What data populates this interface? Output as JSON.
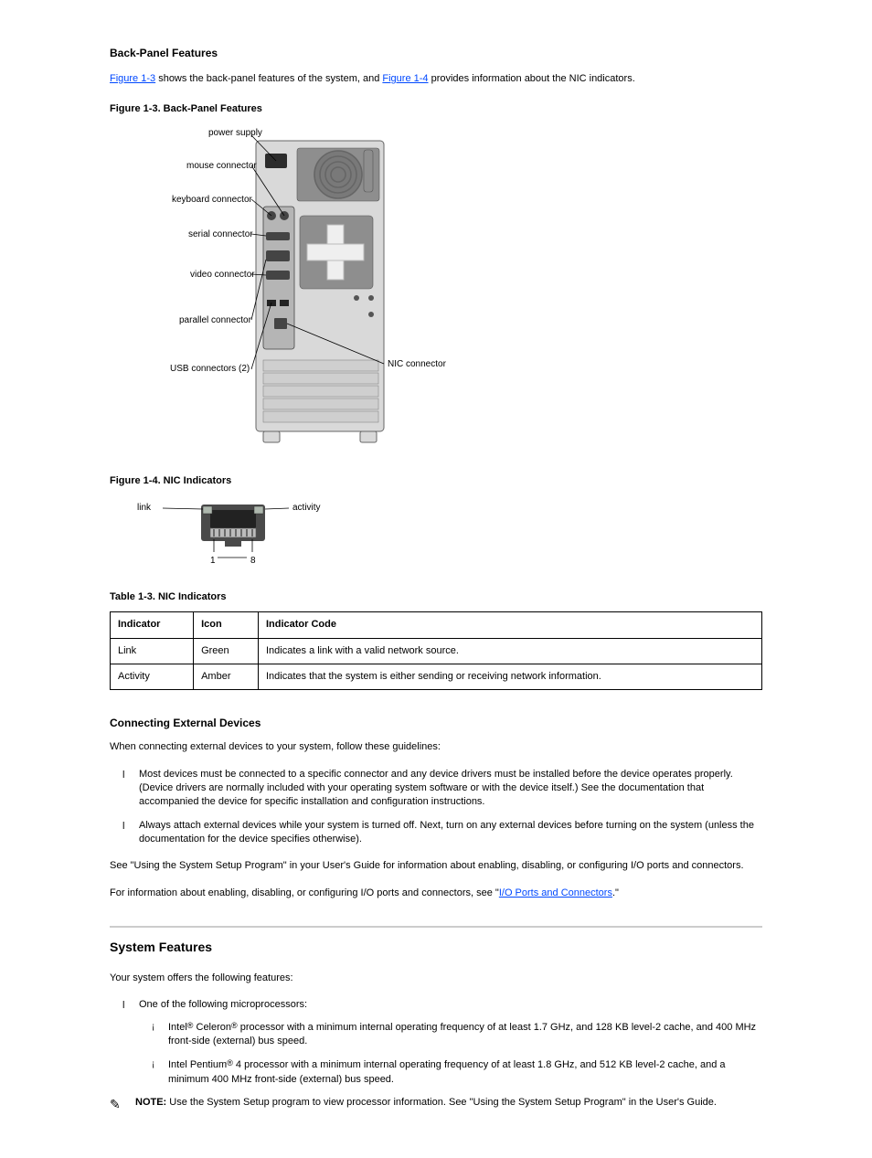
{
  "section1": {
    "title": "Back-Panel Features",
    "intro_parts": [
      " shows the back-panel features of the system, and ",
      " provides information about the NIC indicators."
    ],
    "link1": "Figure 1-3",
    "link2": "Figure 1-4",
    "fig3_label": "Figure 1-3. Back-Panel Features",
    "fig3_labels": {
      "power_supply": "power supply",
      "mouse": "mouse connector",
      "keyboard": "keyboard connector",
      "serial": "serial connector",
      "video": "video connector",
      "parallel": "parallel connector",
      "usb": "USB connectors (2)",
      "nic": "NIC connector"
    },
    "fig4_label": "Figure 1-4. NIC Indicators",
    "fig4_labels": {
      "link": "link",
      "activity": "activity",
      "pin1": "1",
      "pin8": "8"
    },
    "table_label": "Table 1-3. NIC Indicators",
    "table": {
      "headers": [
        "Indicator",
        "Icon",
        "Indicator Code"
      ],
      "rows": [
        [
          "Link",
          "Green",
          "Indicates a link with a valid network source."
        ],
        [
          "Activity",
          "Amber",
          "Indicates that the system is either sending or receiving network information."
        ]
      ]
    },
    "device_sec_title": "Connecting External Devices",
    "device_para": "When connecting external devices to your system, follow these guidelines:",
    "bullet1": "Most devices must be connected to a specific connector and any device drivers must be installed before the device operates properly. (Device drivers are normally included with your operating system software or with the device itself.) See the documentation that accompanied the device for specific installation and configuration instructions.",
    "bullet2": "Always attach external devices while your system is turned off. Next, turn on any external devices before turning on the system (unless the documentation for the device specifies otherwise).",
    "note_para": "See \"Using the System Setup Program\" in your User's Guide for information about enabling, disabling, or configuring I/O ports and connectors.",
    "note_ref_link": "I/O Ports and Connectors",
    "note_ref_before": "For information about enabling, disabling, or configuring I/O ports and connectors, see \"",
    "note_ref_after": ".\""
  },
  "section2": {
    "title": "System Features",
    "intro": "Your system offers the following features:",
    "bullet1_before": "One of the following ",
    "bullet1_mid": "microprocessor",
    "bullet1_after": "s:",
    "sub1": {
      "before": "Intel",
      "mid": " Celeron",
      "after": " processor with a minimum internal operating frequency of at least 1.7 GHz, and 128 KB level-2 cache, and 400 MHz front-side (external) bus speed."
    },
    "sub2": {
      "before": "Intel Pentium",
      "after": " 4 processor with a minimum internal operating frequency of at least 1.8 GHz, and 512 KB level-2 cache, and a minimum 400 MHz front-side (external) bus speed."
    },
    "note_label": "NOTE:",
    "note_text": " Use the System Setup program to view processor information. See \"Using the System Setup Program\" in the User's Guide."
  }
}
